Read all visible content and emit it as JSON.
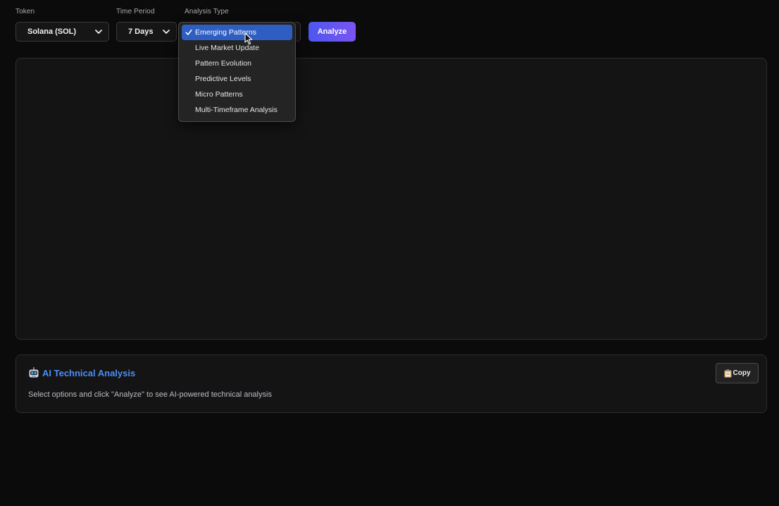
{
  "controls": {
    "token": {
      "label": "Token",
      "value": "Solana (SOL)"
    },
    "time_period": {
      "label": "Time Period",
      "value": "7 Days"
    },
    "analysis_type": {
      "label": "Analysis Type",
      "selected": "Emerging Patterns",
      "options": [
        "Emerging Patterns",
        "Live Market Update",
        "Pattern Evolution",
        "Predictive Levels",
        "Micro Patterns",
        "Multi-Timeframe Analysis"
      ]
    },
    "analyze_label": "Analyze"
  },
  "ai_panel": {
    "title": "AI Technical Analysis",
    "title_icon": "robot-icon",
    "body": "Select options and click \"Analyze\" to see AI-powered technical analysis",
    "copy_label": "Copy",
    "copy_icon": "clipboard-icon"
  },
  "colors": {
    "background": "#0b0b0b",
    "panel": "#141414",
    "accent_blue": "#4e8cf7",
    "selected_item": "#2f5ec2",
    "analyze_gradient_start": "#4d57ee",
    "analyze_gradient_end": "#7b54f1"
  }
}
